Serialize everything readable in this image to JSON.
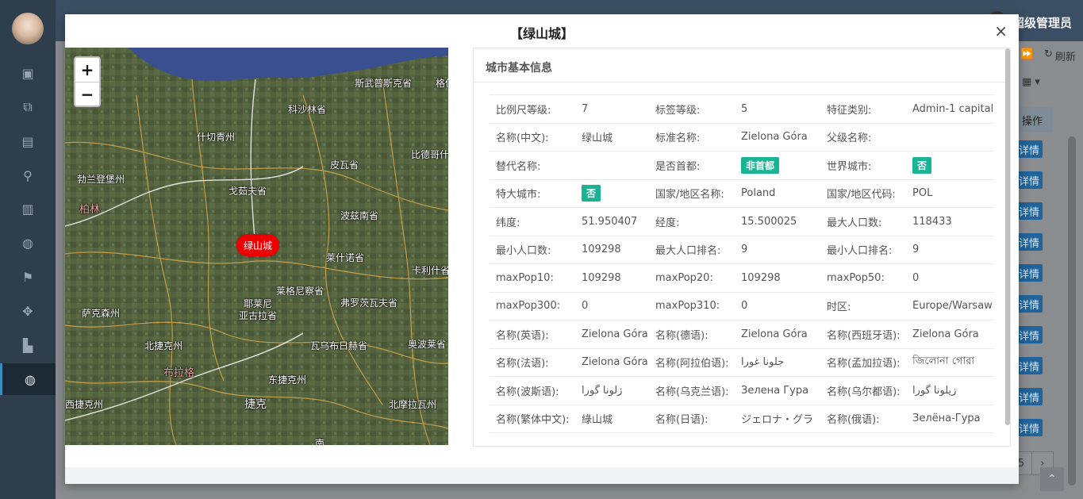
{
  "app": {
    "admin_name": "超级管理员",
    "refresh_label": "刷新",
    "op_header": "操作",
    "op_button": "详情",
    "page_number": "5",
    "page_next": "›"
  },
  "modal": {
    "title": "【绿山城】",
    "close": "×"
  },
  "map": {
    "zoom_in": "+",
    "zoom_out": "−",
    "city_marker": "绿山城",
    "labels": {
      "l1": "斯武普斯克省",
      "l2": "格但",
      "l3": "科沙林省",
      "l4": "什切青州",
      "l5": "比德哥什",
      "l6": "皮瓦省",
      "l7": "勃兰登堡州",
      "l8": "戈茹夫省",
      "l9": "柏林",
      "l10": "波兹南省",
      "l11": "莱什诺省",
      "l12": "卡利什省",
      "l13": "莱格尼察省",
      "l14": "耶莱尼\n亚古拉省",
      "l15": "弗罗茨瓦夫省",
      "l16": "萨克森州",
      "l17": "北捷克州",
      "l18": "瓦乌布日赫省",
      "l19": "奥波莱省",
      "l20": "布拉格",
      "l21": "东捷克州",
      "l22": "西捷克州",
      "l23": "捷克",
      "l24": "北摩拉瓦州",
      "l25": "南"
    }
  },
  "info": {
    "title": "城市基本信息",
    "rows": [
      [
        {
          "k": "比例尺等级:",
          "v": "7"
        },
        {
          "k": "标签等级:",
          "v": "5"
        },
        {
          "k": "特征类别:",
          "v": "Admin-1 capital"
        }
      ],
      [
        {
          "k": "名称(中文):",
          "v": "绿山城"
        },
        {
          "k": "标准名称:",
          "v": "Zielona Góra"
        },
        {
          "k": "父级名称:",
          "v": ""
        }
      ],
      [
        {
          "k": "替代名称:",
          "v": ""
        },
        {
          "k": "是否首都:",
          "v": "非首都",
          "badge": true
        },
        {
          "k": "世界城市:",
          "v": "否",
          "badge": true
        }
      ],
      [
        {
          "k": "特大城市:",
          "v": "否",
          "badge": true
        },
        {
          "k": "国家/地区名称:",
          "v": "Poland"
        },
        {
          "k": "国家/地区代码:",
          "v": "POL"
        }
      ],
      [
        {
          "k": "纬度:",
          "v": "51.950407"
        },
        {
          "k": "经度:",
          "v": "15.500025"
        },
        {
          "k": "最大人口数:",
          "v": "118433"
        }
      ],
      [
        {
          "k": "最小人口数:",
          "v": "109298"
        },
        {
          "k": "最大人口排名:",
          "v": "9"
        },
        {
          "k": "最小人口排名:",
          "v": "9"
        }
      ],
      [
        {
          "k": "maxPop10:",
          "v": "109298"
        },
        {
          "k": "maxPop20:",
          "v": "109298"
        },
        {
          "k": "maxPop50:",
          "v": "0"
        }
      ],
      [
        {
          "k": "maxPop300:",
          "v": "0"
        },
        {
          "k": "maxPop310:",
          "v": "0"
        },
        {
          "k": "时区:",
          "v": "Europe/Warsaw"
        }
      ],
      [
        {
          "k": "名称(英语):",
          "v": "Zielona Góra"
        },
        {
          "k": "名称(德语):",
          "v": "Zielona Góra"
        },
        {
          "k": "名称(西班牙语):",
          "v": "Zielona Góra"
        }
      ],
      [
        {
          "k": "名称(法语):",
          "v": "Zielona Góra"
        },
        {
          "k": "名称(阿拉伯语):",
          "v": "جلونا غورا"
        },
        {
          "k": "名称(孟加拉语):",
          "v": "জিলোনা গোরা"
        }
      ],
      [
        {
          "k": "名称(波斯语):",
          "v": "زلونا گورا"
        },
        {
          "k": "名称(乌克兰语):",
          "v": "Зелена Гура"
        },
        {
          "k": "名称(乌尔都语):",
          "v": "زیلونا گورا"
        }
      ],
      [
        {
          "k": "名称(繁体中文):",
          "v": "綠山城"
        },
        {
          "k": "名称(日语):",
          "v": "ジェロナ・グラ"
        },
        {
          "k": "名称(俄语):",
          "v": "Зелёна-Гура"
        }
      ]
    ]
  }
}
